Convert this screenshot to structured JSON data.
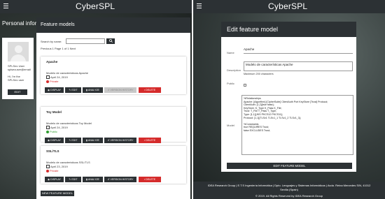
{
  "left": {
    "app_title": "CyberSPL",
    "profile": {
      "title": "Personal information",
      "user_name": "SPLSec User",
      "email": "splsecuser@email",
      "bio_1": "Hi, I'm the",
      "bio_2": "SPLSec user",
      "edit_label": "EDIT"
    },
    "panel_title": "Feature models",
    "search": {
      "label": "Search by name:",
      "value": "",
      "placeholder": ""
    },
    "pagination": "Previous 1 Page 1 of 1 Next",
    "cards": [
      {
        "name": "Apache",
        "description": "Modelo de características Apache",
        "date": "April 24, 2019",
        "visibility": "Private",
        "visibility_color": "#d52b2b"
      },
      {
        "name": "Toy Model",
        "description": "Modelo de características Toy Model",
        "date": "April 24, 2019",
        "visibility": "Public",
        "visibility_color": "#2e9b2e"
      },
      {
        "name": "SSL/TLS",
        "description": "Modelo de características SSL/TLS",
        "date": "April 23, 2019",
        "visibility": "Private",
        "visibility_color": "#d52b2b"
      }
    ],
    "actions": {
      "display": "DISPLAY",
      "edit": "EDIT",
      "analyze": "ANALYZE",
      "history": "VERSION HISTORY",
      "delete": "DELETE"
    },
    "new_button": "NEW FEATURE MODEL"
  },
  "right": {
    "app_title": "CyberSPL",
    "form_title": "Edit feature model",
    "labels": {
      "name": "Name",
      "description": "Description",
      "public": "Public",
      "model": "Model"
    },
    "name_value": "Apache",
    "description_value": "Modelo de características Apache",
    "max_chars": "Maximum 200 characters",
    "public_checked": false,
    "model_text": "%Relationships\nApache: [Algorithm] [CipherSuite] ClientAuth Port KeyStore [Trust] Protocol;\nClientAuth: [1,2]{true false};\nKeyStore: K_Type K_Pass K_File;\nTrust: T_File T_Pass T_Type;\nType: [1,1]{JKS PKCS12 PKCS11};\nProtocol: [1,1]{TLSv1 TLSv1_1 TLSv1_2 TLSv1_3};\n\n%Constraints\ntrue REQUIRES Trust;\nfalse EXCLUDES Trust;",
    "edit_button": "EDIT FEATURE MODEL",
    "footer": {
      "line1": "IDEA Research Group | E.T.S Ingeniería Informática | Dpto. Lenguajes y Sistemas Informáticos | Avda. Reina Mercedes S/N, 41012",
      "line2": "Sevilla (Spain)",
      "line3": "© 2019. All Rights Reserved by IDEA Research Group"
    }
  },
  "colors": {
    "dark": "#2c3134",
    "danger": "#d52b2b",
    "public": "#2e9b2e"
  },
  "icons": [
    "menu-icon",
    "search-icon",
    "eye-icon",
    "pencil-icon",
    "chart-icon",
    "history-icon",
    "trash-icon",
    "calendar-icon",
    "lock-icon",
    "globe-icon"
  ]
}
